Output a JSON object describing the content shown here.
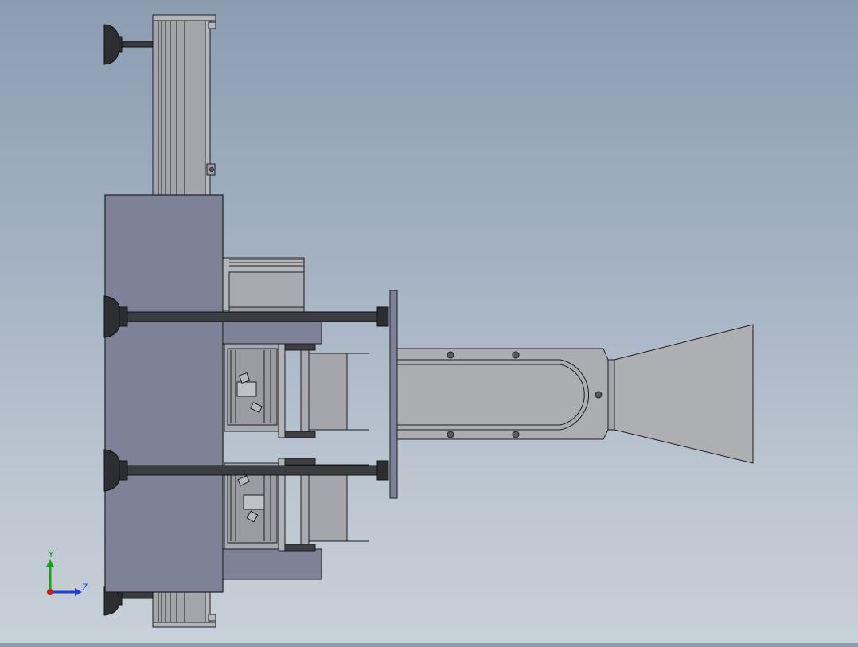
{
  "viewport": {
    "background_top": "#8c9db2",
    "background_bottom": "#c8d0d8",
    "model_colors": {
      "housing": "#7e8296",
      "rail": "#a3a5ab",
      "rod": "#3b3d41",
      "bracket": "#b1b2b6",
      "edge": "#1e1e22"
    }
  },
  "triad": {
    "y_label": "Y",
    "z_label": "Z",
    "y_color": "#16a016",
    "z_color": "#1e3fd6",
    "x_color": "#c81e1e"
  }
}
